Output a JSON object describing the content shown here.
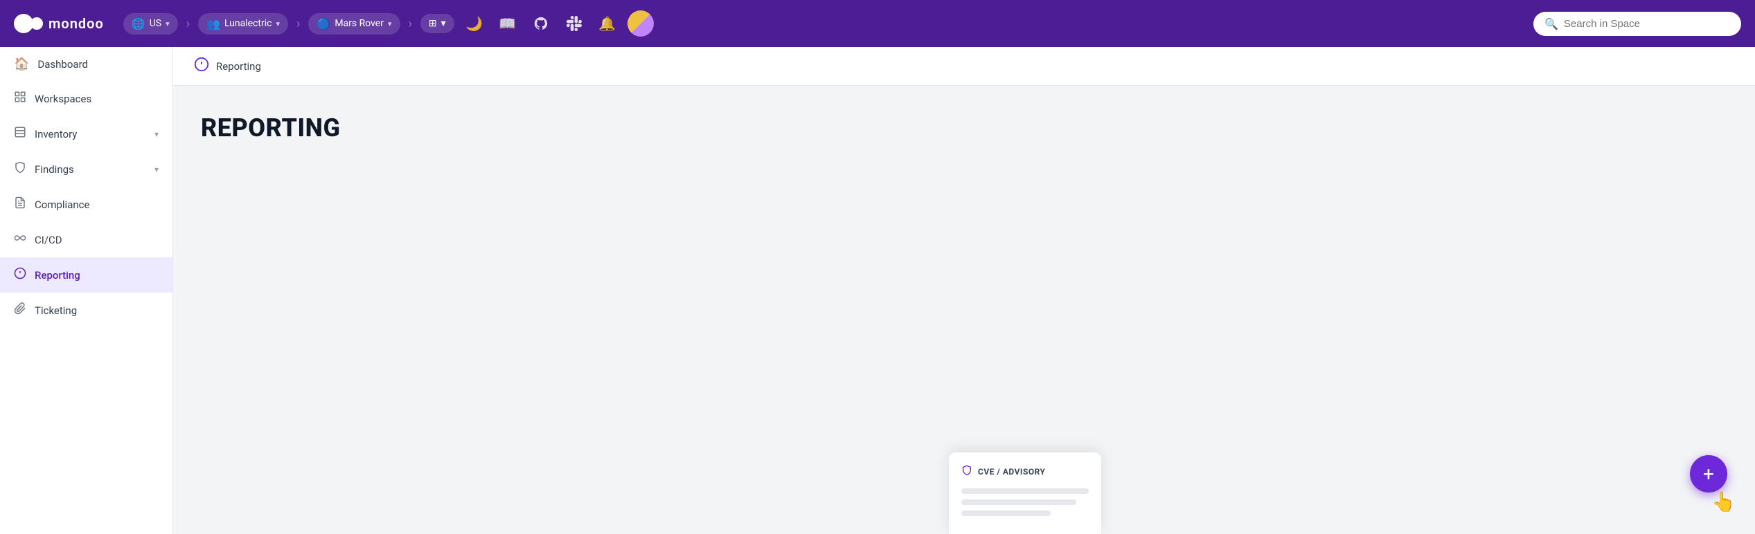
{
  "brand": {
    "name": "mondoo"
  },
  "topnav": {
    "region": "US",
    "org": "Lunalectric",
    "space": "Mars Rover",
    "search_placeholder": "Search in Space",
    "icons": {
      "moon": "🌙",
      "book": "📖",
      "github": "⊙",
      "slack": "✦",
      "bell": "🔔",
      "theme": "◑"
    }
  },
  "sidebar": {
    "items": [
      {
        "id": "dashboard",
        "label": "Dashboard",
        "icon": "home",
        "active": false
      },
      {
        "id": "workspaces",
        "label": "Workspaces",
        "icon": "grid",
        "active": false
      },
      {
        "id": "inventory",
        "label": "Inventory",
        "icon": "building",
        "active": false,
        "has_arrow": true
      },
      {
        "id": "findings",
        "label": "Findings",
        "icon": "shield",
        "active": false,
        "has_arrow": true
      },
      {
        "id": "compliance",
        "label": "Compliance",
        "icon": "file",
        "active": false
      },
      {
        "id": "cicd",
        "label": "CI/CD",
        "icon": "infinity",
        "active": false
      },
      {
        "id": "reporting",
        "label": "Reporting",
        "icon": "report",
        "active": true
      },
      {
        "id": "ticketing",
        "label": "Ticketing",
        "icon": "clip",
        "active": false
      }
    ]
  },
  "breadcrumb": {
    "icon": "📋",
    "text": "Reporting"
  },
  "page": {
    "title": "REPORTING"
  },
  "card_preview": {
    "title": "CVE / ADVISORY"
  },
  "fab": {
    "label": "+"
  }
}
